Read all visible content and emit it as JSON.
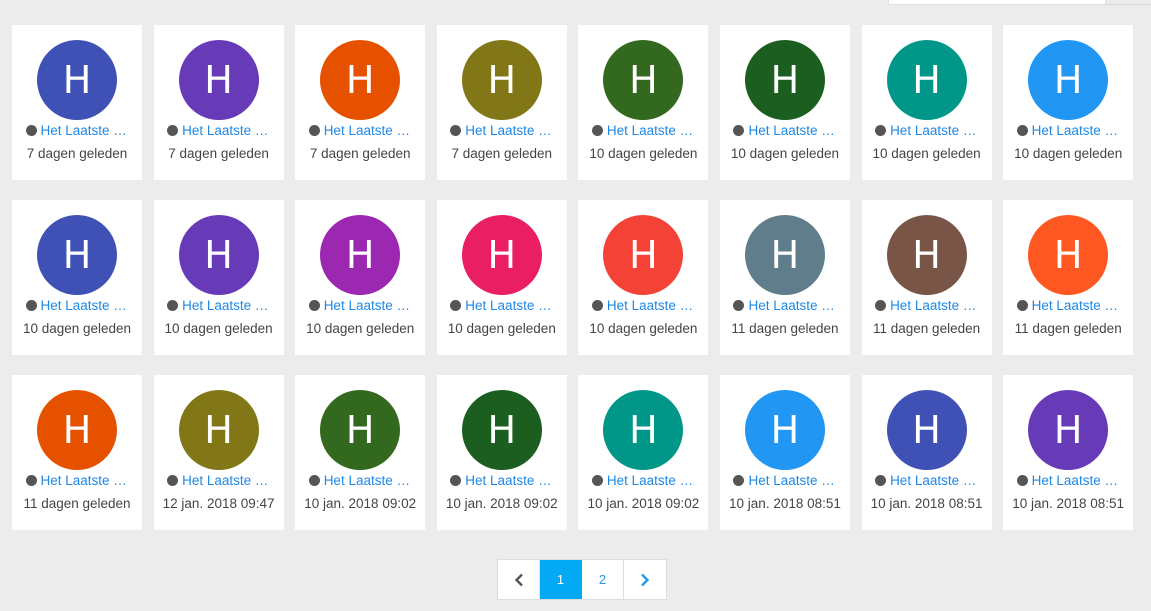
{
  "cards": [
    {
      "initial": "H",
      "name": "Het Laatste Nieuws",
      "time": "7 dagen geleden",
      "color": "#3f51b5"
    },
    {
      "initial": "H",
      "name": "Het Laatste Nieuws",
      "time": "7 dagen geleden",
      "color": "#673ab7"
    },
    {
      "initial": "H",
      "name": "Het Laatste Nieuws",
      "time": "7 dagen geleden",
      "color": "#e65100"
    },
    {
      "initial": "H",
      "name": "Het Laatste Nieuws",
      "time": "7 dagen geleden",
      "color": "#827717"
    },
    {
      "initial": "H",
      "name": "Het Laatste Nieuws",
      "time": "10 dagen geleden",
      "color": "#33691e"
    },
    {
      "initial": "H",
      "name": "Het Laatste Nieuws",
      "time": "10 dagen geleden",
      "color": "#1b5e20"
    },
    {
      "initial": "H",
      "name": "Het Laatste Nieuws",
      "time": "10 dagen geleden",
      "color": "#009688"
    },
    {
      "initial": "H",
      "name": "Het Laatste Nieuws",
      "time": "10 dagen geleden",
      "color": "#2196f3"
    },
    {
      "initial": "H",
      "name": "Het Laatste Nieuws",
      "time": "10 dagen geleden",
      "color": "#3f51b5"
    },
    {
      "initial": "H",
      "name": "Het Laatste Nieuws",
      "time": "10 dagen geleden",
      "color": "#673ab7"
    },
    {
      "initial": "H",
      "name": "Het Laatste Nieuws",
      "time": "10 dagen geleden",
      "color": "#9c27b0"
    },
    {
      "initial": "H",
      "name": "Het Laatste Nieuws",
      "time": "10 dagen geleden",
      "color": "#e91e63"
    },
    {
      "initial": "H",
      "name": "Het Laatste Nieuws",
      "time": "10 dagen geleden",
      "color": "#f44336"
    },
    {
      "initial": "H",
      "name": "Het Laatste Nieuws",
      "time": "11 dagen geleden",
      "color": "#607d8b"
    },
    {
      "initial": "H",
      "name": "Het Laatste Nieuws",
      "time": "11 dagen geleden",
      "color": "#795548"
    },
    {
      "initial": "H",
      "name": "Het Laatste Nieuws",
      "time": "11 dagen geleden",
      "color": "#ff5722"
    },
    {
      "initial": "H",
      "name": "Het Laatste Nieuws",
      "time": "11 dagen geleden",
      "color": "#e65100"
    },
    {
      "initial": "H",
      "name": "Het Laatste Nieuws",
      "time": "12 jan. 2018 09:47",
      "color": "#827717"
    },
    {
      "initial": "H",
      "name": "Het Laatste Nieuws",
      "time": "10 jan. 2018 09:02",
      "color": "#33691e"
    },
    {
      "initial": "H",
      "name": "Het Laatste Nieuws",
      "time": "10 jan. 2018 09:02",
      "color": "#1b5e20"
    },
    {
      "initial": "H",
      "name": "Het Laatste Nieuws",
      "time": "10 jan. 2018 09:02",
      "color": "#009688"
    },
    {
      "initial": "H",
      "name": "Het Laatste Nieuws",
      "time": "10 jan. 2018 08:51",
      "color": "#2196f3"
    },
    {
      "initial": "H",
      "name": "Het Laatste Nieuws",
      "time": "10 jan. 2018 08:51",
      "color": "#3f51b5"
    },
    {
      "initial": "H",
      "name": "Het Laatste Nieuws",
      "time": "10 jan. 2018 08:51",
      "color": "#673ab7"
    }
  ],
  "pagination": {
    "prev_icon": "chevron-left-icon",
    "pages": [
      "1",
      "2"
    ],
    "active_page": "1",
    "next_icon": "chevron-right-icon",
    "active_color": "#03a9f4"
  }
}
